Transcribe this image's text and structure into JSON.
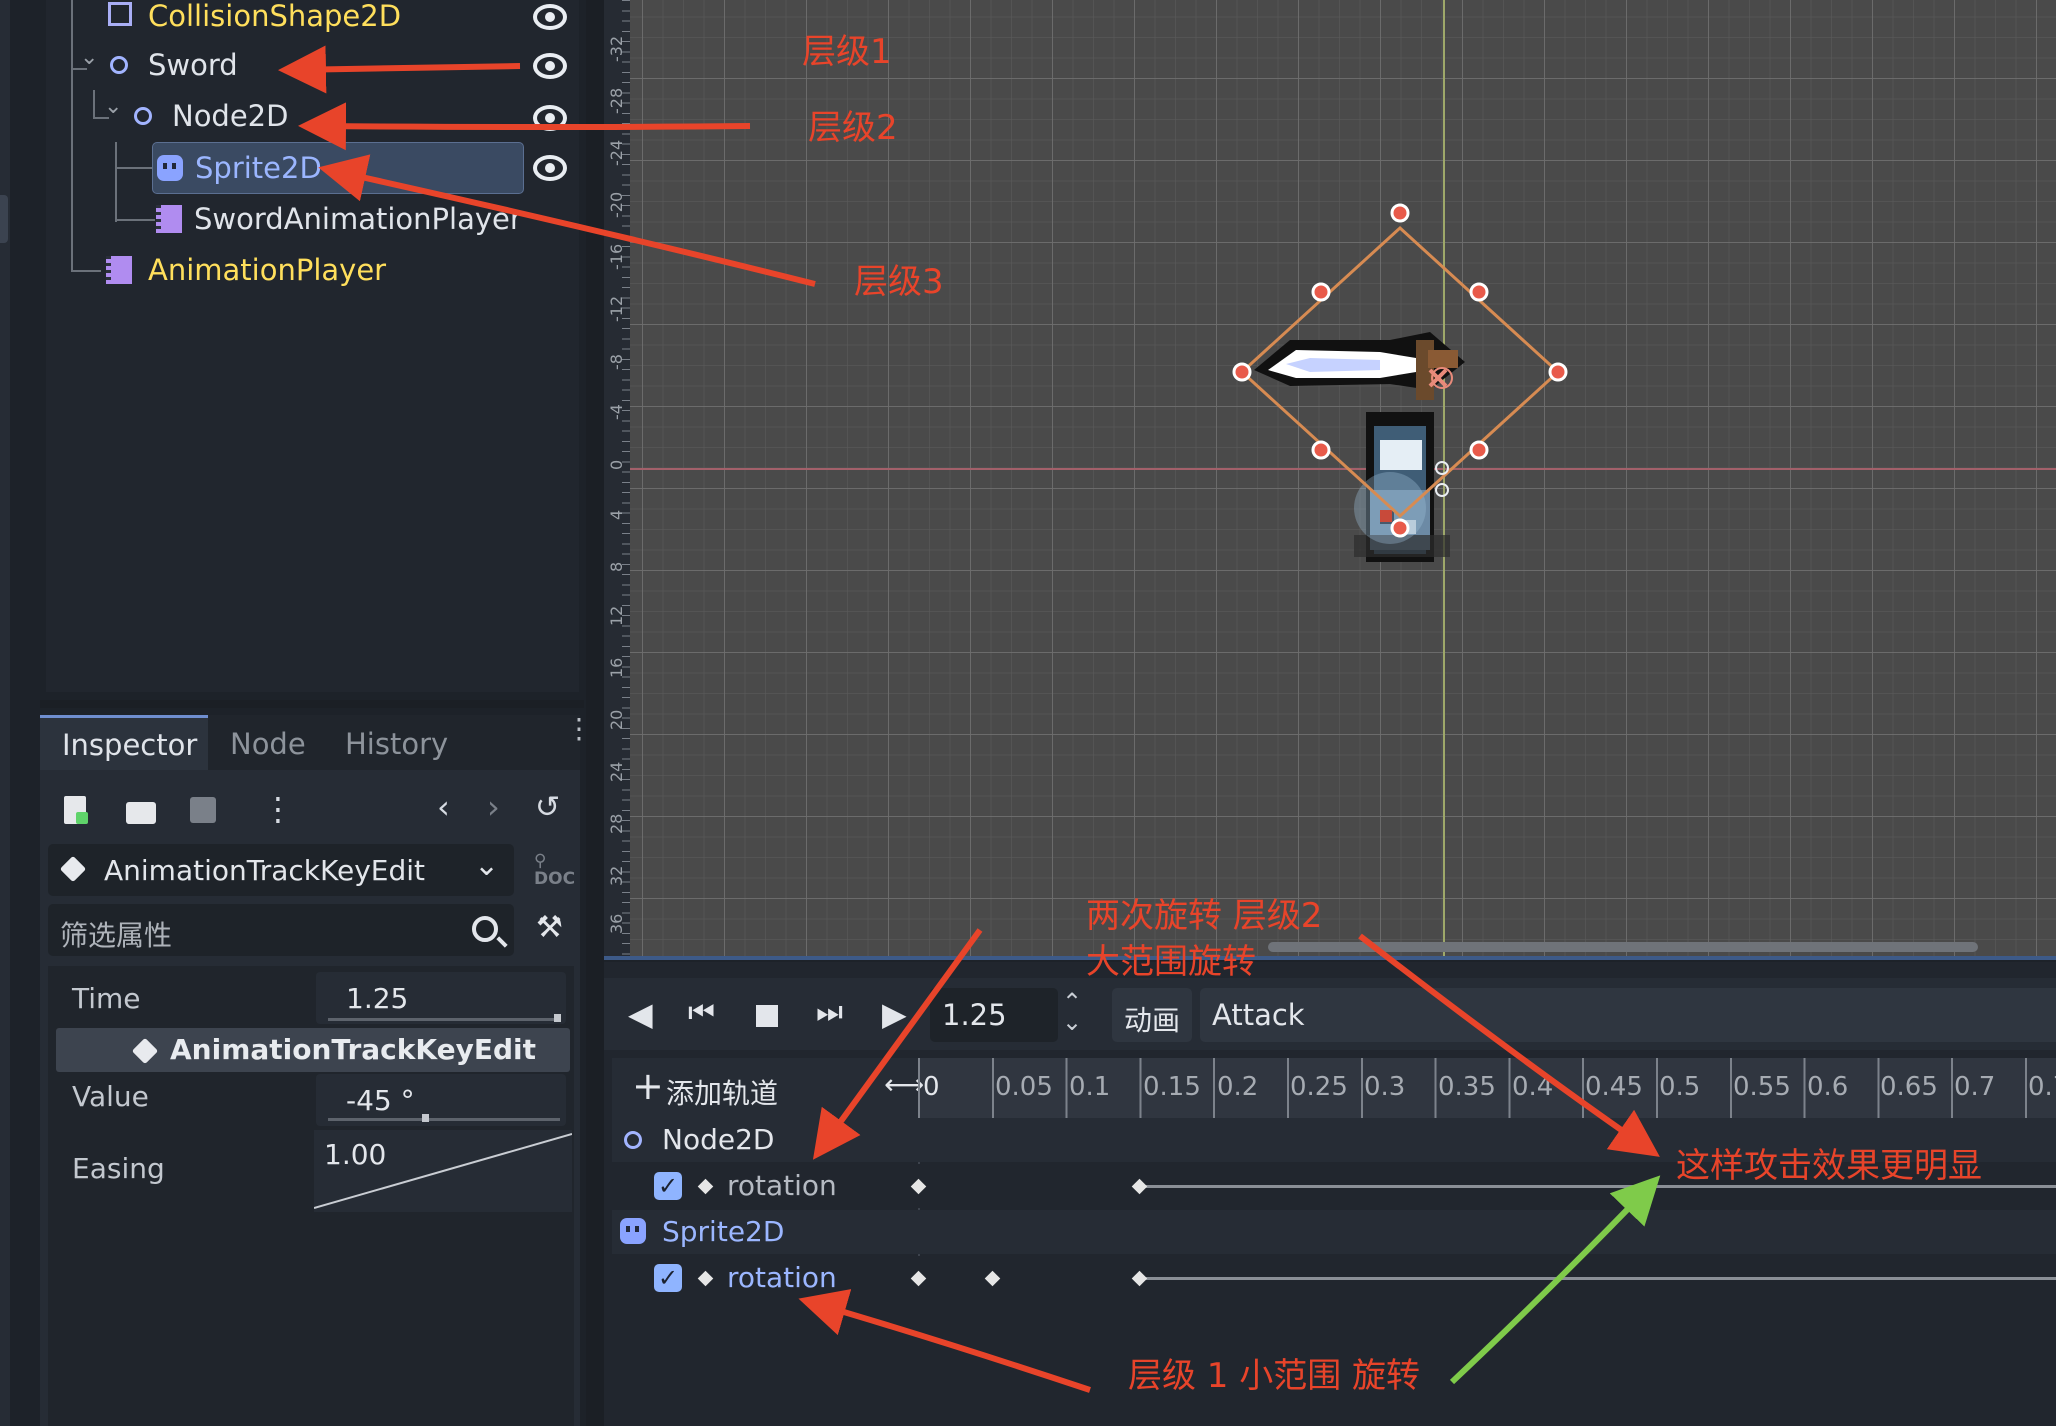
{
  "scene_tree": {
    "nodes": [
      {
        "label": "CollisionShape2D"
      },
      {
        "label": "Sword"
      },
      {
        "label": "Node2D"
      },
      {
        "label": "Sprite2D"
      },
      {
        "label": "SwordAnimationPlayer"
      },
      {
        "label": "AnimationPlayer"
      }
    ]
  },
  "inspector": {
    "tabs": [
      "Inspector",
      "Node",
      "History"
    ],
    "object_type": "AnimationTrackKeyEdit",
    "filter_placeholder": "筛选属性",
    "section_title": "AnimationTrackKeyEdit",
    "properties": {
      "time_label": "Time",
      "time_value": "1.25",
      "value_label": "Value",
      "value_value": "-45 °",
      "easing_label": "Easing",
      "easing_value": "1.00"
    }
  },
  "animation_panel": {
    "current_time": "1.25",
    "animation_button": "动画",
    "animation_name": "Attack",
    "add_track": "添加轨道",
    "ruler_ticks": [
      "0",
      "0.05",
      "0.1",
      "0.15",
      "0.2",
      "0.25",
      "0.3",
      "0.35",
      "0.4",
      "0.45",
      "0.5",
      "0.55",
      "0.6",
      "0.65",
      "0.7",
      "0.7"
    ],
    "tracks": [
      {
        "node": "Node2D",
        "property": "rotation"
      },
      {
        "node": "Sprite2D",
        "property": "rotation"
      }
    ]
  },
  "viewport": {
    "ruler_labels": [
      "-32",
      "-28",
      "-24",
      "-20",
      "-16",
      "-12",
      "-8",
      "-4",
      "0",
      "4",
      "8",
      "12",
      "16",
      "20",
      "24",
      "28",
      "32",
      "36"
    ]
  },
  "annotations": {
    "level1": "层级1",
    "level2": "层级2",
    "level3": "层级3",
    "two_rotations_line1": "两次旋转 层级2",
    "two_rotations_line2": "大范围旋转",
    "effect": "这样攻击效果更明显",
    "small_rotation": "层级 1 小范围 旋转"
  },
  "colors": {
    "accent_red": "#e8442a",
    "accent_green": "#7fcb4a",
    "node_yellow": "#ffdf5c",
    "selection_blue": "#3a4a62"
  }
}
